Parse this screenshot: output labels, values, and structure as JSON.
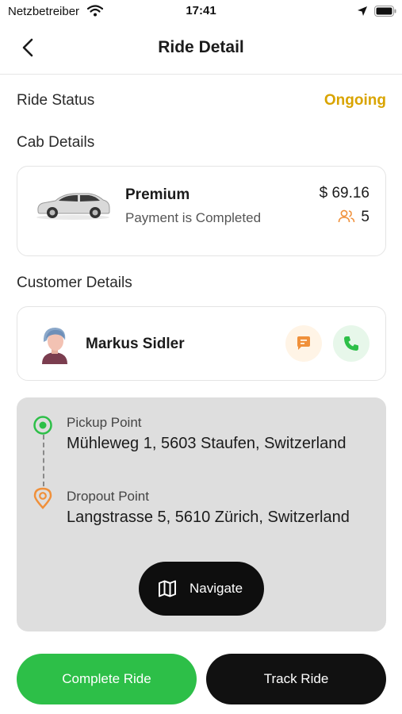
{
  "status_bar": {
    "carrier": "Netzbetreiber",
    "time": "17:41"
  },
  "header": {
    "title": "Ride Detail"
  },
  "ride_status": {
    "label": "Ride Status",
    "value": "Ongoing",
    "value_color": "#d9a400"
  },
  "cab": {
    "section_label": "Cab Details",
    "type": "Premium",
    "payment_status": "Payment is Completed",
    "price": "$ 69.16",
    "seats": "5"
  },
  "customer": {
    "section_label": "Customer Details",
    "name": "Markus Sidler"
  },
  "route": {
    "pickup_label": "Pickup Point",
    "pickup_address": "Mühleweg 1, 5603 Staufen, Switzerland",
    "dropout_label": "Dropout Point",
    "dropout_address": "Langstrasse 5, 5610 Zürich, Switzerland",
    "navigate_label": "Navigate"
  },
  "actions": {
    "complete_label": "Complete Ride",
    "track_label": "Track Ride"
  },
  "colors": {
    "accent_green": "#2dbf48",
    "accent_orange": "#f0903a",
    "dark": "#111111"
  },
  "icons": {
    "wifi": "wifi-icon",
    "location": "location-arrow-icon",
    "battery": "battery-icon",
    "back": "chevron-left-icon",
    "car": "car-icon",
    "seats": "users-icon",
    "chat": "chat-icon",
    "call": "phone-icon",
    "pickup": "pickup-pin-icon",
    "dropout": "dropout-pin-icon",
    "map": "map-icon"
  }
}
